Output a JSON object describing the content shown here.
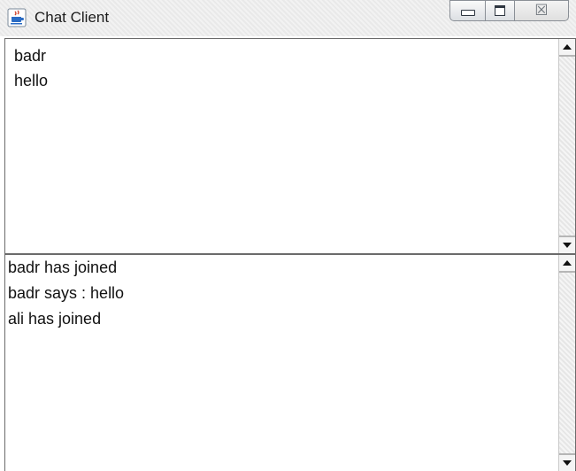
{
  "window": {
    "title": "Chat Client",
    "icon": "java-cup-icon",
    "controls": {
      "minimize": "minimize-icon",
      "maximize": "maximize-icon",
      "close": "close-icon"
    }
  },
  "users_pane": {
    "lines": [
      "badr",
      "hello"
    ]
  },
  "messages_pane": {
    "lines": [
      "badr has joined",
      "badr says : hello",
      "ali has joined"
    ]
  }
}
